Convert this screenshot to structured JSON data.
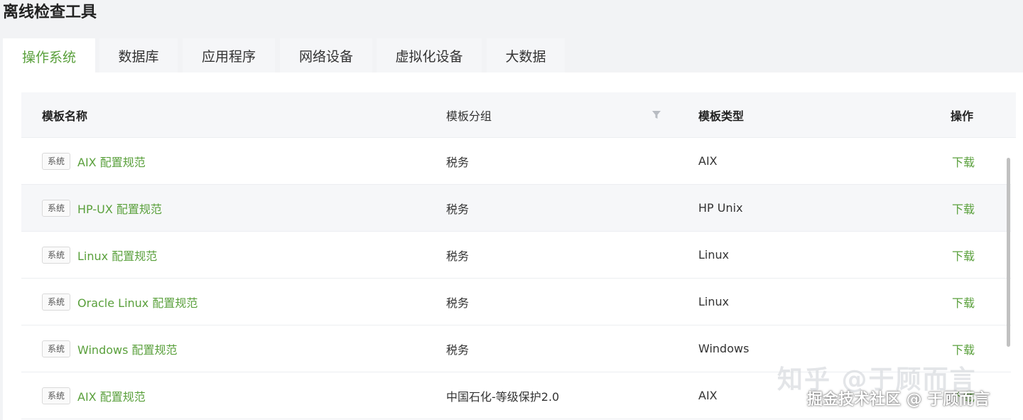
{
  "page_title": "离线检查工具",
  "tabs": [
    {
      "label": "操作系统",
      "active": true
    },
    {
      "label": "数据库",
      "active": false
    },
    {
      "label": "应用程序",
      "active": false
    },
    {
      "label": "网络设备",
      "active": false
    },
    {
      "label": "虚拟化设备",
      "active": false
    },
    {
      "label": "大数据",
      "active": false
    }
  ],
  "table": {
    "headers": {
      "name": "模板名称",
      "group": "模板分组",
      "type": "模板类型",
      "action": "操作"
    },
    "rows": [
      {
        "tag": "系统",
        "name": "AIX 配置规范",
        "group": "税务",
        "type": "AIX",
        "action": "下载"
      },
      {
        "tag": "系统",
        "name": "HP-UX 配置规范",
        "group": "税务",
        "type": "HP Unix",
        "action": "下载"
      },
      {
        "tag": "系统",
        "name": "Linux 配置规范",
        "group": "税务",
        "type": "Linux",
        "action": "下载"
      },
      {
        "tag": "系统",
        "name": "Oracle Linux 配置规范",
        "group": "税务",
        "type": "Linux",
        "action": "下载"
      },
      {
        "tag": "系统",
        "name": "Windows 配置规范",
        "group": "税务",
        "type": "Windows",
        "action": "下载"
      },
      {
        "tag": "系统",
        "name": "AIX 配置规范",
        "group": "中国石化-等级保护2.0",
        "type": "AIX",
        "action": "下载"
      }
    ]
  },
  "watermark": {
    "line1": "知乎 @于顾而言",
    "line2": "掘金技术社区 @ 于顾而言"
  },
  "colors": {
    "accent": "#5aa03c",
    "header_bg": "#f6f7f9"
  },
  "icons": {
    "group_filter": "filter-icon"
  }
}
